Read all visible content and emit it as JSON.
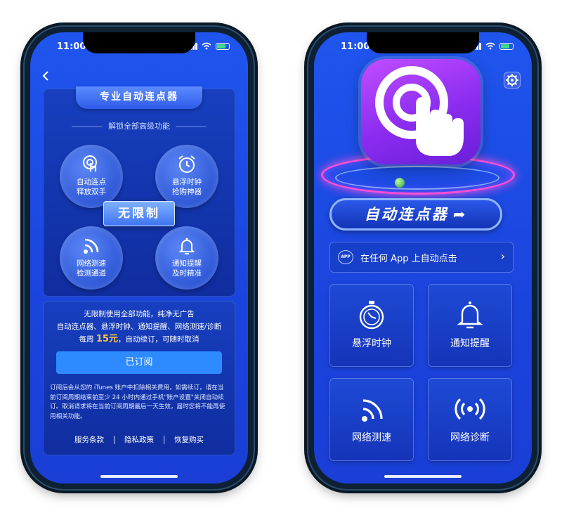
{
  "status": {
    "time": "11:00"
  },
  "left": {
    "ribbon_title": "专业自动连点器",
    "unlock_subtitle": "解锁全部高级功能",
    "unlimited_badge": "无限制",
    "features": [
      {
        "icon": "tap-icon",
        "label": "自动连点\n释放双手"
      },
      {
        "icon": "alarm-icon",
        "label": "悬浮时钟\n抢购神器"
      },
      {
        "icon": "wifi-icon",
        "label": "网络测速\n检测通道"
      },
      {
        "icon": "bell-icon",
        "label": "通知提醒\n及时精准"
      }
    ],
    "desc_line1": "无限制使用全部功能，纯净无广告",
    "desc_line2": "自动连点器、悬浮时钟、通知提醒、网络测速/诊断",
    "desc_line3_pre": "每周 ",
    "price": "15元",
    "desc_line3_post": "，自动续订，可随时取消",
    "subscribe_button": "已订阅",
    "terms": "订阅后会从您的 iTunes 账户中扣除相关费用，如需续订，请在当前订阅周期结束前至少 24 小时内通过手机\"账户设置\"关闭自动续订。取消请求将在当前订阅周期最后一天生效，届时您将不能再使用相关功能。",
    "links": [
      "服务条款",
      "隐私政策",
      "恢复购买"
    ]
  },
  "right": {
    "title": "自动连点器",
    "any_app_badge": "APP",
    "any_app_text": "在任何 App 上自动点击",
    "tiles": [
      {
        "icon": "stopwatch-icon",
        "label": "悬浮时钟"
      },
      {
        "icon": "bell-icon",
        "label": "通知提醒"
      },
      {
        "icon": "wifi-icon",
        "label": "网络测速"
      },
      {
        "icon": "broadcast-icon",
        "label": "网络诊断"
      }
    ]
  }
}
